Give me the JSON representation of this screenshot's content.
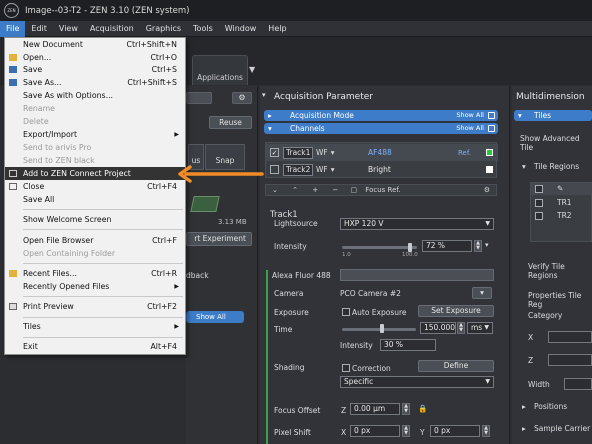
{
  "window": {
    "title": "Image--03-T2 - ZEN 3.10 (ZEN system)",
    "logo_text": "ZEN"
  },
  "menubar": [
    "File",
    "Edit",
    "View",
    "Acquisition",
    "Graphics",
    "Tools",
    "Window",
    "Help"
  ],
  "toolbar": {
    "applications_label": "Applications"
  },
  "file_menu": {
    "items": [
      {
        "label": "New Document",
        "shortcut": "Ctrl+Shift+N",
        "disabled": false
      },
      {
        "label": "Open...",
        "shortcut": "Ctrl+O",
        "disabled": false
      },
      {
        "label": "Save",
        "shortcut": "Ctrl+S",
        "disabled": false
      },
      {
        "label": "Save As...",
        "shortcut": "Ctrl+Shift+S",
        "disabled": false
      },
      {
        "label": "Save As with Options...",
        "shortcut": "",
        "disabled": false
      },
      {
        "label": "Rename",
        "shortcut": "",
        "disabled": true
      },
      {
        "label": "Delete",
        "shortcut": "",
        "disabled": true
      },
      {
        "label": "Export/Import",
        "shortcut": "",
        "disabled": false
      },
      {
        "label": "Send to arivis Pro",
        "shortcut": "",
        "disabled": true
      },
      {
        "label": "Send to ZEN black",
        "shortcut": "",
        "disabled": true
      },
      {
        "label": "Add to ZEN Connect Project",
        "shortcut": "",
        "disabled": false
      },
      {
        "label": "Close",
        "shortcut": "Ctrl+F4",
        "disabled": false
      },
      {
        "label": "Save All",
        "shortcut": "",
        "disabled": false
      },
      {
        "label": "Show Welcome Screen",
        "shortcut": "",
        "disabled": false
      },
      {
        "label": "Open File Browser",
        "shortcut": "Ctrl+F",
        "disabled": false
      },
      {
        "label": "Open Containing Folder",
        "shortcut": "",
        "disabled": true
      },
      {
        "label": "Recent Files...",
        "shortcut": "Ctrl+R",
        "disabled": false
      },
      {
        "label": "Recently Opened Files",
        "shortcut": "",
        "disabled": false
      },
      {
        "label": "Print Preview",
        "shortcut": "Ctrl+F2",
        "disabled": false
      },
      {
        "label": "Tiles",
        "shortcut": "",
        "disabled": false
      },
      {
        "label": "Exit",
        "shortcut": "Alt+F4",
        "disabled": false
      }
    ]
  },
  "left_panel": {
    "reuse": "Reuse",
    "us": "us",
    "snap": "Snap",
    "size": "3.13 MB",
    "start_experiment": "rt Experiment",
    "feedback": "dback",
    "show_all": "Show All"
  },
  "acquisition": {
    "header": "Acquisition Parameter",
    "acq_mode": "Acquisition Mode",
    "channels": "Channels",
    "show_all": "Show All",
    "tracks": [
      {
        "name": "Track1",
        "mode": "WF",
        "dye": "AF488",
        "ref": "Ref.",
        "checked": true,
        "dye_color": "#7fb2ff",
        "swatch": "#22cc33"
      },
      {
        "name": "Track2",
        "mode": "WF",
        "dye": "Bright",
        "ref": "",
        "checked": false,
        "dye_color": "#e6e6e6",
        "swatch": "#ffffff"
      }
    ],
    "track_tools": {
      "plus": "+",
      "minus": "−",
      "focus_ref": "Focus Ref."
    },
    "track1_label": "Track1",
    "lightsource_label": "Lightsource",
    "lightsource_value": "HXP 120 V",
    "intensity_label": "Intensity",
    "intensity_value": "72 %",
    "intensity_min": "1.0",
    "intensity_max": "100.0",
    "fluor_label": "Alexa Fluor 488",
    "camera_label": "Camera",
    "camera_value": "PCO Camera #2",
    "exposure_label": "Exposure",
    "auto_exposure": "Auto Exposure",
    "set_exposure": "Set Exposure",
    "time_label": "Time",
    "time_value": "150.000",
    "time_unit": "ms",
    "cam_intensity_label": "Intensity",
    "cam_intensity_value": "30 %",
    "shading_label": "Shading",
    "correction": "Correction",
    "define": "Define",
    "shading_mode": "Specific",
    "focus_offset_label": "Focus Offset",
    "focus_z": "Z",
    "focus_value": "0.00 µm",
    "pixel_shift_label": "Pixel Shift",
    "px_x": "X",
    "px_x_value": "0 px",
    "px_y": "Y",
    "px_y_value": "0 px"
  },
  "multidim": {
    "header": "Multidimension",
    "tiles": "Tiles",
    "show_advanced": "Show Advanced Tile",
    "tile_regions": "Tile Regions",
    "tr1": "TR1",
    "tr2": "TR2",
    "verify": "Verify Tile Regions",
    "properties": "Properties Tile Reg",
    "category": "Category",
    "x": "X",
    "z": "Z",
    "width": "Width",
    "positions": "Positions",
    "sample_carrier": "Sample Carrier"
  },
  "colors": {
    "accent": "#3d7cc9",
    "arrow": "#f28c28",
    "highlight": "#333333"
  }
}
